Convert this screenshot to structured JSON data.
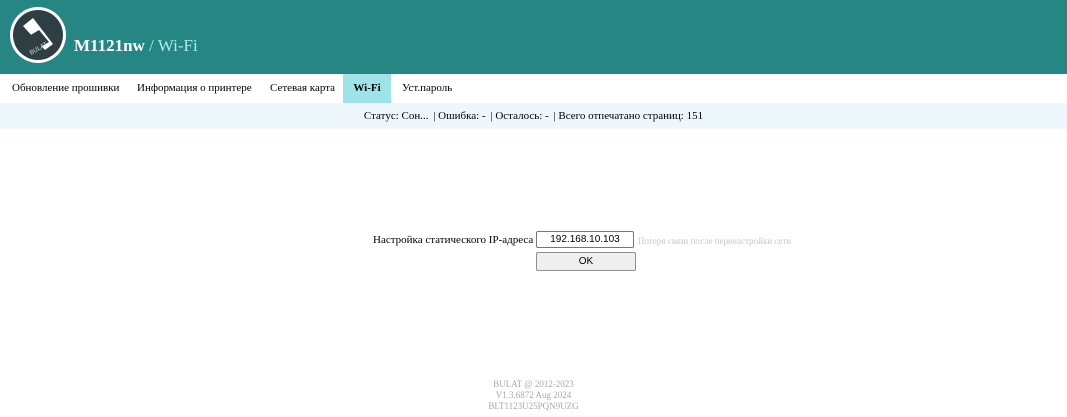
{
  "header": {
    "model": "M1121nw",
    "separator": " / ",
    "page": "Wi-Fi",
    "logo_text": "BULAT"
  },
  "nav": {
    "items": [
      {
        "label": "Обновление прошивки"
      },
      {
        "label": "Информация о принтере"
      },
      {
        "label": "Сетевая карта"
      },
      {
        "label": "Wi-Fi",
        "active": true
      },
      {
        "label": "Уст.пароль"
      }
    ]
  },
  "status": {
    "state": "Статус: Сон...",
    "error": "| Ошибка: -",
    "remaining": "| Осталось: -",
    "total": "| Всего отпечатано страниц: 151"
  },
  "form": {
    "label": "Настройка статического IP-адреса",
    "ip_value": "192.168.10.103",
    "hint": "Потеря связи после перенастройки сети",
    "ok_label": "OK"
  },
  "footer": {
    "copyright": "BULAT @ 2012-2023",
    "version": "V1.3.6872 Aug 2024",
    "serial": "BLT1123U25PQN9UZG"
  },
  "colors": {
    "header_bg": "#258684",
    "active_tab_bg": "#9fe3e8",
    "status_bg": "#eef7fb"
  }
}
